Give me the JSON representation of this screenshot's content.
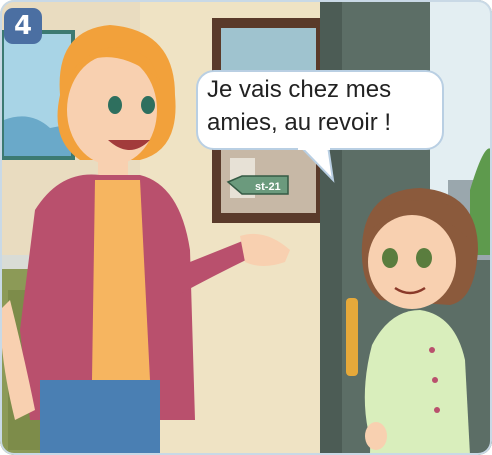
{
  "panel": {
    "number": "4",
    "speech": {
      "line1": "Je vais chez mes",
      "line2": "amies, au revoir !"
    },
    "street_sign": "st-21"
  },
  "colors": {
    "badge": "#4b6fa2",
    "wall": "#efe3c4",
    "door": "#52625b",
    "cardigan": "#b9506d",
    "top": "#f6b560",
    "jeans": "#4a7fb3",
    "hair_woman": "#f2a13b",
    "hair_girl": "#8b5a3c",
    "pajamas": "#d9eebc"
  }
}
